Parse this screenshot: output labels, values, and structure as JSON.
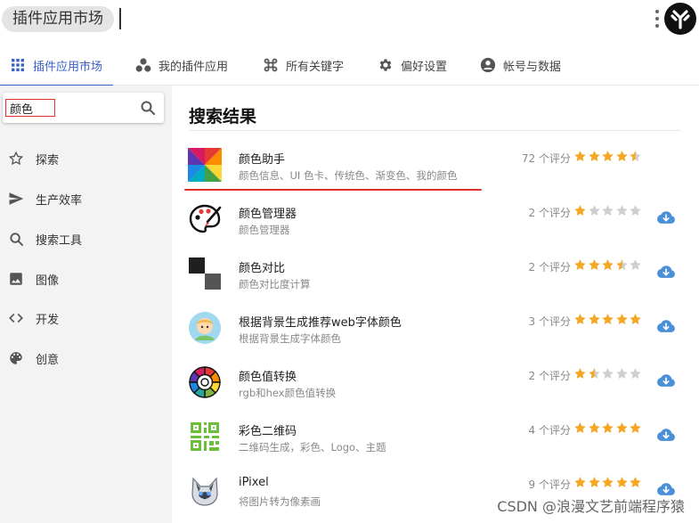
{
  "app": {
    "title": "插件应用市场"
  },
  "tabs": [
    {
      "label": "插件应用市场",
      "icon": "grid-icon",
      "active": true
    },
    {
      "label": "我的插件应用",
      "icon": "dots-cluster-icon",
      "active": false
    },
    {
      "label": "所有关键字",
      "icon": "command-icon",
      "active": false
    },
    {
      "label": "偏好设置",
      "icon": "gear-icon",
      "active": false
    },
    {
      "label": "帐号与数据",
      "icon": "account-icon",
      "active": false
    }
  ],
  "search": {
    "value": "颜色"
  },
  "sidebar": {
    "items": [
      {
        "label": "探索",
        "icon": "star-outline-icon"
      },
      {
        "label": "生产效率",
        "icon": "send-icon"
      },
      {
        "label": "搜索工具",
        "icon": "search-icon"
      },
      {
        "label": "图像",
        "icon": "image-icon"
      },
      {
        "label": "开发",
        "icon": "code-icon"
      },
      {
        "label": "创意",
        "icon": "palette-icon"
      }
    ]
  },
  "results": {
    "title": "搜索结果",
    "items": [
      {
        "name": "颜色助手",
        "desc": "颜色信息、UI 色卡、传统色、渐变色、我的颜色",
        "count": "72 个评分",
        "rating": 4.5,
        "installed": true,
        "icon": "color-wheel-square-icon"
      },
      {
        "name": "颜色管理器",
        "desc": "颜色管理器",
        "count": "2 个评分",
        "rating": 1,
        "installed": false,
        "icon": "palette-icon"
      },
      {
        "name": "颜色对比",
        "desc": "颜色对比度计算",
        "count": "2 个评分",
        "rating": 3.5,
        "installed": false,
        "icon": "contrast-squares-icon"
      },
      {
        "name": "根据背景生成推荐web字体颜色",
        "desc": "根据背景生成字体颜色",
        "count": "3 个评分",
        "rating": 5,
        "installed": false,
        "icon": "avatar-icon"
      },
      {
        "name": "颜色值转换",
        "desc": "rgb和hex颜色值转换",
        "count": "2 个评分",
        "rating": 1.5,
        "installed": false,
        "icon": "color-ring-icon"
      },
      {
        "name": "彩色二维码",
        "desc": "二维码生成，彩色、Logo、主题",
        "count": "4 个评分",
        "rating": 5,
        "installed": false,
        "icon": "qr-code-icon"
      },
      {
        "name": "iPixel",
        "desc": "将图片转为像素画",
        "count": "9 个评分",
        "rating": 5,
        "installed": false,
        "icon": "cat-icon"
      }
    ]
  },
  "colors": {
    "accent": "#3a62c5",
    "star": "#f5a623",
    "star_empty": "#cfcfcf",
    "download": "#4a90d9",
    "highlight": "#e0312b"
  },
  "watermark": "CSDN @浪漫文艺前端程序猿"
}
